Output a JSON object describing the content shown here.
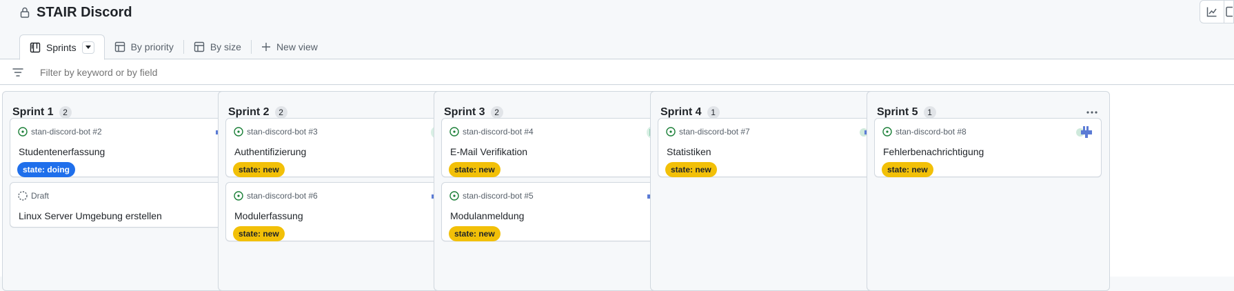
{
  "project": {
    "title": "STAIR Discord"
  },
  "tabs": [
    {
      "label": "Sprints",
      "icon": "board-icon"
    },
    {
      "label": "By priority",
      "icon": "table-icon"
    },
    {
      "label": "By size",
      "icon": "table-icon"
    },
    {
      "label": "New view",
      "icon": "plus-icon"
    }
  ],
  "filter": {
    "placeholder": "Filter by keyword or by field"
  },
  "colors": {
    "doing": "#1f6feb",
    "new": "#f2c008",
    "open": "#1a7f37"
  },
  "columns": [
    {
      "title": "Sprint 1",
      "count": "2",
      "cards": [
        {
          "ref": "stan-discord-bot #2",
          "title": "Studentenerfassung",
          "label": "state: doing",
          "status": "open",
          "avatar": "bot-avatar-blue"
        },
        {
          "ref": "Draft",
          "title": "Linux Server Umgebung erstellen",
          "status": "draft"
        }
      ]
    },
    {
      "title": "Sprint 2",
      "count": "2",
      "cards": [
        {
          "ref": "stan-discord-bot #3",
          "title": "Authentifizierung",
          "label": "state: new",
          "status": "open",
          "avatar": "bot-avatar-green"
        },
        {
          "ref": "stan-discord-bot #6",
          "title": "Modulerfassung",
          "label": "state: new",
          "status": "open",
          "avatar": "bot-avatar-blue"
        }
      ]
    },
    {
      "title": "Sprint 3",
      "count": "2",
      "cards": [
        {
          "ref": "stan-discord-bot #4",
          "title": "E-Mail Verifikation",
          "label": "state: new",
          "status": "open",
          "avatar": "bot-avatar-green"
        },
        {
          "ref": "stan-discord-bot #5",
          "title": "Modulanmeldung",
          "label": "state: new",
          "status": "open",
          "avatar": "bot-avatar-blue"
        }
      ]
    },
    {
      "title": "Sprint 4",
      "count": "1",
      "cards": [
        {
          "ref": "stan-discord-bot #7",
          "title": "Statistiken",
          "label": "state: new",
          "status": "open",
          "avatar": "bot-avatar-multi"
        }
      ]
    },
    {
      "title": "Sprint 5",
      "count": "1",
      "cards": [
        {
          "ref": "stan-discord-bot #8",
          "title": "Fehlerbenachrichtigung",
          "label": "state: new",
          "status": "open",
          "avatar": "bot-avatar-multi"
        }
      ]
    }
  ]
}
